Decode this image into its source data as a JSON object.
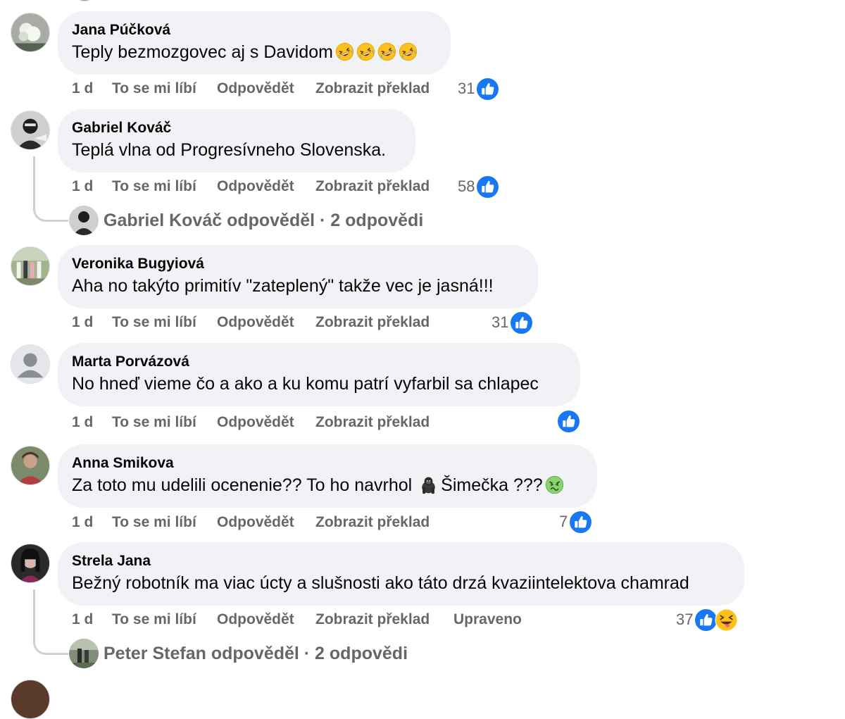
{
  "ui": {
    "like_label": "To se mi líbí",
    "reply_label": "Odpovědět",
    "translate_label": "Zobrazit překlad",
    "accent_color": "#1877f2",
    "bubble_color": "#f0f2f5",
    "meta_color": "#65676b"
  },
  "comments": [
    {
      "author": "Jana Púčková",
      "text": "Teply bezmozgovec aj s Davidom",
      "emojis": [
        "rolling-laughing",
        "rolling-laughing",
        "rolling-laughing",
        "rolling-laughing"
      ],
      "time": "1 d",
      "reactions": "31",
      "reaction_icons": [
        "like-icon"
      ]
    },
    {
      "author": "Gabriel Kováč",
      "text": "Teplá vlna od Progresívneho Slovenska.",
      "time": "1 d",
      "reactions": "58",
      "reaction_icons": [
        "like-icon"
      ],
      "replies": "Gabriel Kováč odpověděl · 2 odpovědi"
    },
    {
      "author": "Veronika Bugyiová",
      "text": "Aha no takýto primitív \"zateplený\" takže vec je jasná!!!",
      "time": "1 d",
      "reactions": "31",
      "reaction_icons": [
        "like-icon"
      ]
    },
    {
      "author": "Marta Porvázová",
      "text": "No hneď vieme čo a ako a ku komu patrí vyfarbil sa chlapec",
      "time": "1 d",
      "reactions": "",
      "reaction_icons": [
        "like-icon"
      ]
    },
    {
      "author": "Anna Smikova",
      "text_before": "Za toto mu udelili ocenenie?? To ho navrhol ",
      "text_after": "Šimečka ???",
      "emojis": [
        "gorilla",
        "nauseated-face"
      ],
      "time": "1 d",
      "reactions": "7",
      "reaction_icons": [
        "like-icon"
      ]
    },
    {
      "author": "Strela Jana",
      "text": "Bežný robotník ma viac úcty a slušnosti ako táto drzá kvaziintelektova chamrad",
      "time": "1 d",
      "edited": "Upraveno",
      "reactions": "37",
      "reaction_icons": [
        "like-icon",
        "squinting-tongue-face"
      ],
      "replies": "Peter Stefan odpověděl · 2 odpovědi"
    }
  ]
}
